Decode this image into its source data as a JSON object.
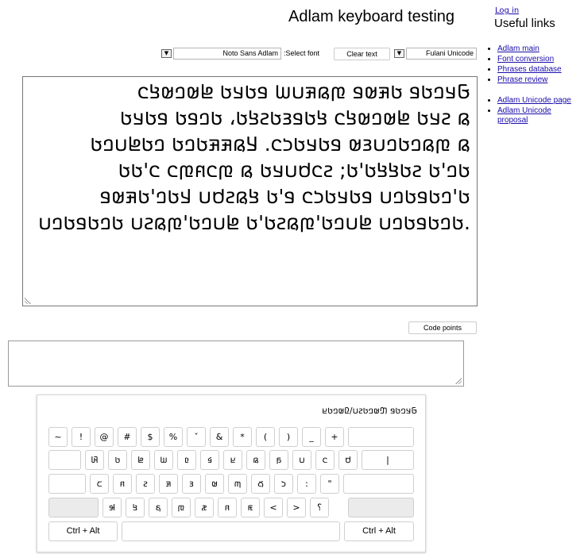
{
  "header": {
    "title": "Adlam keyboard testing",
    "login": "Log in",
    "useful_links_title": "Useful links"
  },
  "useful_links": [
    "Adlam main",
    "Font conversion",
    "Phrases database",
    "Phrase review",
    "Adlam Unicode page",
    "Adlam Unicode proposal"
  ],
  "toolbar": {
    "font_select_value": "Noto Sans Adlam",
    "select_font_label": ":Select font",
    "clear_text_label": "Clear text",
    "keyboard_select_value": "Fulani Unicode",
    "dropdown_glyph": "▼"
  },
  "main_text": {
    "lines": [
      "𞤀𞤣𞤤𞤢𞤥 𞤢𞤳𞤵𞤥 𞤼𞤫𞤳𞤭𞤧 𞤥𞤢𞤣𞤢 𞤦𞤵𞤤𞤵𞤺𞤮",
      "𞤫 𞤲𞤣𞤢 𞤦𞤵𞤤𞤵𞤺𞤮 𞤺𞤢𞤥𞤴𞤢𞤲𞤺𞤢، 𞤢𞤤𞤥𞤢 𞤥𞤢𞤣𞤢",
      "𞤫 𞤼𞤫𞤤𞤢𞤤𞤭𞤴𞤵 𞤥𞤢𞤣𞤢𞤸𞤮. 𞤁𞤫𞤳𞤳𞤢𞤤𞤢 𞤤𞤢𞤦𞤭𞤤𞤢",
      "𞤢𞤤'𞤢 𞤲𞤢𞤺𞤺𞤢'𞤢; 𞤲𞤮𞤯𞤭𞤣𞤢 𞤫 𞤼𞤮𞤱𞤼𞤮 𞤮'𞤢𞤢",
      "𞤢'𞤤𞤢𞤥𞤢𞤤𞤭 𞤥𞤢𞤣𞤢𞤸𞤮 𞤥'𞤢 𞤺𞤫𞤲𞤯𞤭 𞤣𞤢𞤤'𞤢𞤳𞤵𞤥",
      ".𞤢𞤤𞤢𞤥𞤢𞤤𞤭 𞤦𞤭𞤤𞤢'𞤼𞤫𞤲𞤢'𞤢 𞤦𞤭𞤤𞤢'𞤼𞤫𞤲𞤭 𞤢𞤤𞤢𞤥𞤢𞤤𞤭"
    ]
  },
  "code_points_label": "Code points",
  "keyboard": {
    "name": "𞤀𞤣𞤤𞤢𞤥 𞤔𞤵𞤤𞤢𞤲𞤭/𞤆𞤵𞤤𞤢𞤪",
    "row1": [
      "~",
      "!",
      "@",
      "#",
      "$",
      "%",
      "ˇ",
      "&",
      "*",
      "(",
      ")",
      "_",
      "+",
      ""
    ],
    "row2": [
      "",
      "𞤡",
      "𞤢",
      "𞤦",
      "𞤧",
      "𞤨",
      "𞤩",
      "𞤪",
      "𞤫",
      "𞤬",
      "𞤭",
      "𞤮",
      "𞤯",
      "|"
    ],
    "row3": [
      "",
      "𞤰",
      "𞤱",
      "𞤲",
      "𞤳",
      "𞤴",
      "𞤵",
      "𞤶",
      "𞤷",
      "𞤸",
      ":",
      "\"",
      ""
    ],
    "row4": [
      "",
      "𞤹",
      "𞤺",
      "𞤻",
      "𞤼",
      "𞤽",
      "𞤾",
      "𞤿",
      "<",
      ">",
      "؟",
      ""
    ],
    "ctrl_alt_left": "Ctrl + Alt",
    "ctrl_alt_right": "Ctrl + Alt"
  }
}
